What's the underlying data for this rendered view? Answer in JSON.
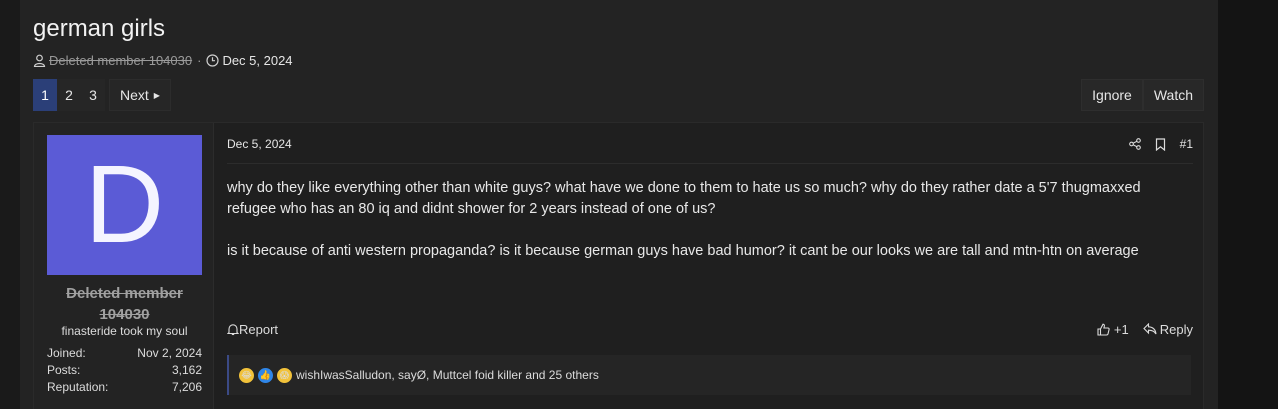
{
  "thread": {
    "title": "german girls",
    "author": "Deleted member 104030",
    "date": "Dec 5, 2024"
  },
  "pagination": {
    "pages": [
      "1",
      "2",
      "3"
    ],
    "active": "1",
    "next_label": "Next"
  },
  "thread_actions": {
    "ignore_label": "Ignore",
    "watch_label": "Watch"
  },
  "post": {
    "date": "Dec 5, 2024",
    "number": "#1",
    "paragraphs": [
      "why do they like everything other than white guys? what have we done to them to hate us so much? why do they rather date a 5'7 thugmaxxed refugee who has an 80 iq and didnt shower for 2 years instead of one of us?",
      "is it because of anti western propaganda? is it because german guys have bad humor? it cant be our looks we are tall and mtn-htn on average"
    ],
    "report_label": "Report",
    "like_count": "+1",
    "reply_label": "Reply",
    "reactions_text": "wishIwasSalludon, sayØ, Muttcel foid killer and 25 others"
  },
  "user": {
    "avatar_letter": "D",
    "name": "Deleted member 104030",
    "title": "finasteride took my soul",
    "stats": [
      {
        "label": "Joined:",
        "value": "Nov 2, 2024"
      },
      {
        "label": "Posts:",
        "value": "3,162"
      },
      {
        "label": "Reputation:",
        "value": "7,206"
      }
    ]
  },
  "colors": {
    "avatar_bg": "#5b5bd6",
    "active_page": "#2b3f78",
    "reaction_bar": "#3b4a86"
  }
}
